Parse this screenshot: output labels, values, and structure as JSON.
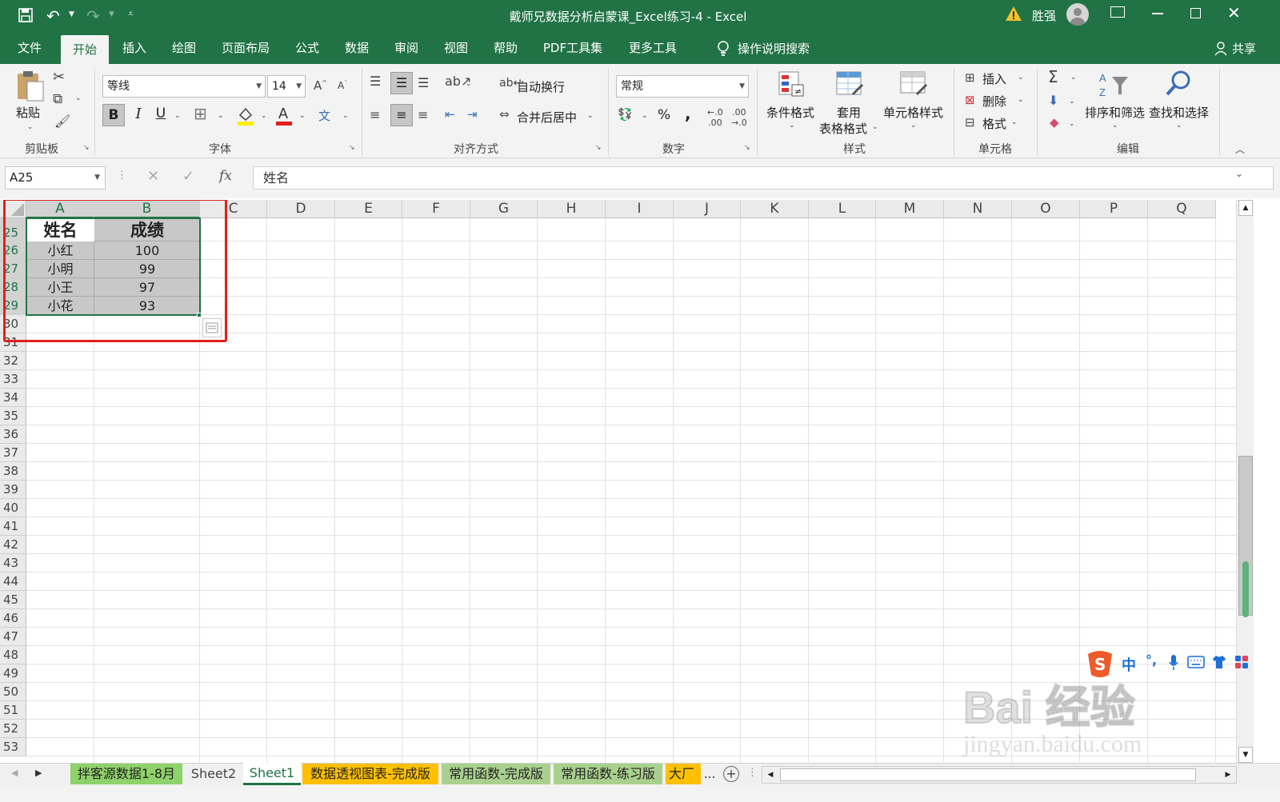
{
  "titlebar": {
    "title": "戴师兄数据分析启蒙课_Excel练习-4  -  Excel",
    "user": "胜强"
  },
  "tabs": [
    {
      "label": "文件"
    },
    {
      "label": "开始"
    },
    {
      "label": "插入"
    },
    {
      "label": "绘图"
    },
    {
      "label": "页面布局"
    },
    {
      "label": "公式"
    },
    {
      "label": "数据"
    },
    {
      "label": "审阅"
    },
    {
      "label": "视图"
    },
    {
      "label": "帮助"
    },
    {
      "label": "PDF工具集"
    },
    {
      "label": "更多工具"
    }
  ],
  "search_label": "操作说明搜索",
  "share_label": "共享",
  "ribbon": {
    "clipboard": {
      "paste": "粘贴",
      "group": "剪贴板"
    },
    "font": {
      "name": "等线",
      "size": "14",
      "group": "字体",
      "bold": "B",
      "italic": "I",
      "underline": "U"
    },
    "align": {
      "wrap": "自动换行",
      "merge": "合并后居中",
      "group": "对齐方式"
    },
    "number": {
      "format": "常规",
      "percent": "%",
      "comma": ",",
      "group": "数字"
    },
    "styles": {
      "cond": "条件格式",
      "table1": "套用",
      "table2": "表格格式",
      "cell": "单元格样式",
      "group": "样式"
    },
    "cells": {
      "insert": "插入",
      "delete": "删除",
      "format": "格式",
      "group": "单元格"
    },
    "edit": {
      "sort": "排序和筛选",
      "find": "查找和选择",
      "group": "编辑"
    }
  },
  "formula": {
    "namebox": "A25",
    "fx": "fx",
    "content": "姓名"
  },
  "columns": [
    "A",
    "B",
    "C",
    "D",
    "E",
    "F",
    "G",
    "H",
    "I",
    "J",
    "K",
    "L",
    "M",
    "N",
    "O",
    "P",
    "Q"
  ],
  "rows": [
    "25",
    "26",
    "27",
    "28",
    "29",
    "30",
    "31",
    "32",
    "33",
    "34",
    "35",
    "36",
    "37",
    "38",
    "39",
    "40",
    "41",
    "42",
    "43",
    "44",
    "45",
    "46",
    "47",
    "48",
    "49",
    "50",
    "51",
    "52",
    "53"
  ],
  "table": {
    "header": [
      "姓名",
      "成绩"
    ],
    "data": [
      [
        "小红",
        "100"
      ],
      [
        "小明",
        "99"
      ],
      [
        "小王",
        "97"
      ],
      [
        "小花",
        "93"
      ]
    ]
  },
  "sheets": [
    {
      "label": "拌客源数据1-8月"
    },
    {
      "label": "Sheet2"
    },
    {
      "label": "Sheet1"
    },
    {
      "label": "数据透视图表-完成版"
    },
    {
      "label": "常用函数-完成版"
    },
    {
      "label": "常用函数-练习版"
    },
    {
      "label": "大厂"
    }
  ],
  "sheet_more": "...",
  "ime": {
    "lang": "中",
    "punct": "°,"
  },
  "watermark": {
    "logo": "Bai 经验",
    "url": "jingyan.baidu.com"
  }
}
